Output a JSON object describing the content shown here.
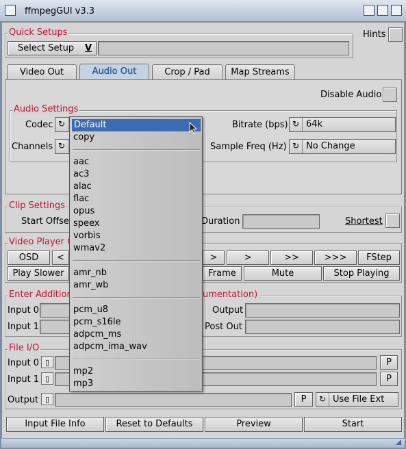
{
  "window": {
    "title": "ffmpegGUI  v3.3"
  },
  "quick_setups": {
    "label": "Quick Setups",
    "select_label": "Select Setup",
    "select_arrow": "V",
    "hints_label": "Hints"
  },
  "tabs": [
    {
      "label": "Video Out"
    },
    {
      "label": "Audio Out"
    },
    {
      "label": "Crop / Pad"
    },
    {
      "label": "Map Streams"
    }
  ],
  "audio": {
    "disable_label": "Disable Audio",
    "settings_title": "Audio Settings",
    "codec_label": "Codec",
    "channels_label": "Channels",
    "bitrate_label": "Bitrate (bps)",
    "bitrate_value": "64k",
    "samplefreq_label": "Sample Freq (Hz)",
    "samplefreq_value": "No Change"
  },
  "clip": {
    "title": "Clip Settings",
    "start_offset_label": "Start Offset",
    "duration_label": "Duration",
    "shortest_label": "Shortest"
  },
  "player": {
    "title": "Video Player Controls",
    "osd_label": "OSD",
    "rewind_label": "<",
    "fwd1_label": ">",
    "fwd2_label": ">",
    "fwd3_label": ">>",
    "fwd4_label": ">>>",
    "fstep_label": "FStep",
    "play_slower_label": "Play Slower",
    "frame_label": "Frame",
    "mute_label": "Mute",
    "stop_label": "Stop Playing"
  },
  "extra": {
    "title_left": "Enter Additional",
    "title_right": "umentation)",
    "input0_label": "Input 0",
    "input1_label": "Input 1",
    "output_label": "Output",
    "postout_label": "Post Out"
  },
  "fileio": {
    "title": "File I/O",
    "input0_label": "Input 0",
    "input1_label": "Input 1",
    "output_label": "Output",
    "p_label": "P",
    "use_file_ext_label": "Use File Ext"
  },
  "bottom_buttons": {
    "input_file_info": "Input File Info",
    "reset_defaults": "Reset to Defaults",
    "preview": "Preview",
    "start": "Start"
  },
  "codec_dropdown": {
    "groups": [
      [
        "Default",
        "copy"
      ],
      [
        "aac",
        "ac3",
        "alac",
        "flac",
        "opus",
        "speex",
        "vorbis",
        "wmav2"
      ],
      [
        "amr_nb",
        "amr_wb"
      ],
      [
        "pcm_u8",
        "pcm_s16le",
        "adpcm_ms",
        "adpcm_ima_wav"
      ],
      [
        "mp2",
        "mp3"
      ]
    ],
    "selected": "Default"
  },
  "colors": {
    "group_title": "#c8102e",
    "selection": "#3c6cb4",
    "active_tab": "#c4d3e4"
  },
  "icons": [
    "close-icon",
    "iconify-icon",
    "depth-icon",
    "zoom-icon",
    "cycle-icon",
    "file-icon",
    "mouse-pointer-icon",
    "resize-grip-icon"
  ]
}
